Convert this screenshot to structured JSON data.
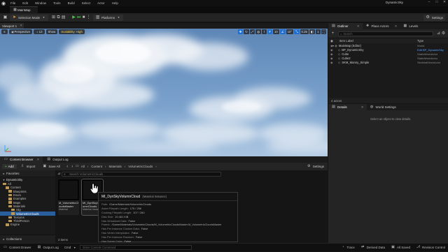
{
  "menu": {
    "items": [
      "File",
      "Edit",
      "Window",
      "Tools",
      "Build",
      "Select",
      "Actor",
      "Help"
    ],
    "project_name": "DynamicSky"
  },
  "level_tab": {
    "label": "MainMap"
  },
  "toolbar": {
    "selection_mode": "Selection Mode",
    "platforms": "Platforms",
    "settings": "Settings"
  },
  "viewport": {
    "tab_label": "Viewport 1",
    "perspective": "Perspective",
    "lit": "Lit",
    "show": "Show",
    "scalability": "Scalability: High",
    "grid_snap": "10",
    "rotation_snap": "10°",
    "scale_snap": "0.25",
    "camera_speed": "1"
  },
  "content_browser": {
    "tabs": [
      "Content Browser",
      "Output Log"
    ],
    "add_label": "Add",
    "import_label": "Import",
    "save_all_label": "Save All",
    "breadcrumbs": [
      "All",
      "Content",
      "Materials",
      "VolumetricClouds"
    ],
    "settings_label": "Settings",
    "favorites_label": "Favorites",
    "project_label": "DynamicSky",
    "search_placeholder": "Search VolumetricClouds",
    "tree": [
      {
        "label": "All",
        "level": 0
      },
      {
        "label": "Content",
        "level": 1
      },
      {
        "label": "Blueprints",
        "level": 2
      },
      {
        "label": "Enum",
        "level": 2
      },
      {
        "label": "Examples",
        "level": 2
      },
      {
        "label": "Maps",
        "level": 2
      },
      {
        "label": "Materials",
        "level": 2
      },
      {
        "label": "Sky",
        "level": 3
      },
      {
        "label": "VolumetricClouds",
        "level": 3
      },
      {
        "label": "Textures",
        "level": 2
      },
      {
        "label": "ThirdPerson",
        "level": 2
      },
      {
        "label": "Engine",
        "level": 1
      }
    ],
    "tree_selected_index": 8,
    "collections_label": "Collections",
    "item_count": "2 items",
    "assets": [
      {
        "name": "M_VolumetricCloudsMaster",
        "kind": "Material"
      },
      {
        "name": "MI_DynSkyVolumnClouds",
        "kind": "Material Instance"
      }
    ]
  },
  "tooltip": {
    "title": "MI_DynSkyVolumnCloud",
    "kind": "(Material Instance)",
    "rows": [
      {
        "k": "Path:",
        "v": "/Game/Materials/VolumetricClouds"
      },
      {
        "k": "Asset Filepath Length:",
        "v": "175 / 256"
      },
      {
        "k": "Cooking Filepath Length:",
        "v": "107 / 260"
      },
      {
        "k": "Disk Size:",
        "v": "10.461 KiB"
      },
      {
        "k": "Has Virtualized Data:",
        "v": "False"
      },
      {
        "k": "Parent:",
        "v": "/Game/Materials/VolumetricClouds/M_VolumetricCloudsMaster.M_VolumetricCloudsMaster"
      },
      {
        "k": "Has Per Instance Custom Data:",
        "v": "False"
      },
      {
        "k": "Has Vertex Interpolator:",
        "v": "False"
      },
      {
        "k": "Has Per Instance Random:",
        "v": "False"
      },
      {
        "k": "Has Scene Color:",
        "v": "False"
      }
    ]
  },
  "status_bar": {
    "content_drawer": "Content Drawer",
    "output_log": "Output Log",
    "cmd": "Cmd",
    "console_placeholder": "Enter Console Command",
    "trace": "Trace",
    "derived_data": "Derived Data",
    "all_saved": "All Saved",
    "revision_control": "Revision Control"
  },
  "outliner": {
    "tabs": [
      "Outliner",
      "Place Actors",
      "Levels"
    ],
    "search_placeholder": "Search",
    "col_label": "Item Label",
    "col_type": "Type",
    "rows": [
      {
        "label": "MainMap (Editor)",
        "type": "World",
        "indent": 0,
        "link": false
      },
      {
        "label": "BP_DynamicSky",
        "type": "Edit BP_DynamicSky",
        "indent": 1,
        "link": true
      },
      {
        "label": "Cube",
        "type": "StaticMeshActor",
        "indent": 1,
        "link": false
      },
      {
        "label": "Cube2",
        "type": "StaticMeshActor",
        "indent": 1,
        "link": false
      },
      {
        "label": "SKM_Manny_Simple",
        "type": "SkeletalMeshActor",
        "indent": 1,
        "link": false
      }
    ],
    "actor_count": "4 actors"
  },
  "details": {
    "tabs": [
      "Details",
      "World Settings"
    ],
    "hint": "Select an object to view details."
  },
  "colors": {
    "accent": "#1f6fd0",
    "selection": "#2a5f9e",
    "play_green": "#4fc24f",
    "folder": "#b9975b"
  }
}
